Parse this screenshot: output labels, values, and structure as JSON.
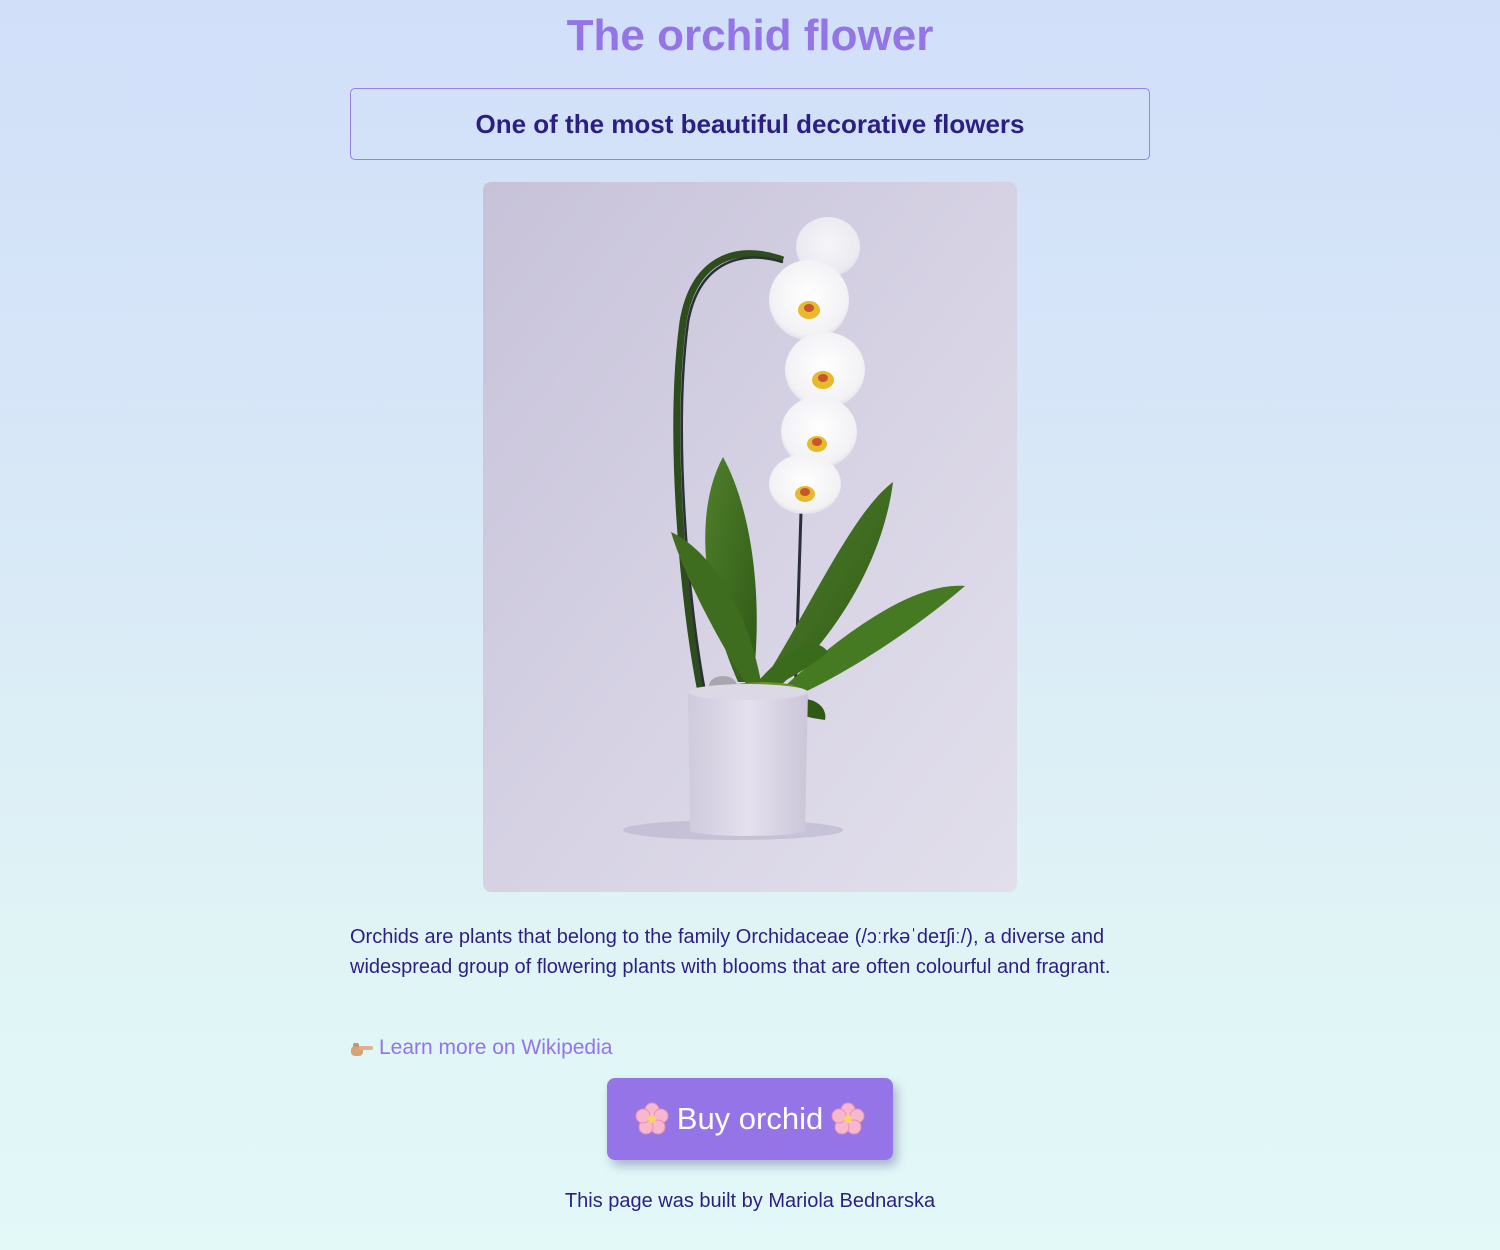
{
  "page": {
    "title": "The orchid flower",
    "subtitle": "One of the most beautiful decorative flowers"
  },
  "image": {
    "alt": "White orchid in a pot"
  },
  "content": {
    "description": "Orchids are plants that belong to the family Orchidaceae (/ɔːrkəˈdeɪʃiː/), a diverse and widespread group of flowering plants with blooms that are often colourful and fragrant."
  },
  "link": {
    "icon": "pointing-hand-icon",
    "label": "Learn more on Wikipedia"
  },
  "button": {
    "label": "Buy orchid",
    "icon": "cherry-blossom-icon"
  },
  "footer": {
    "text": "This page was built by Mariola Bednarska"
  },
  "colors": {
    "accent": "#9474e6",
    "text": "#2c1f82",
    "button_text": "#ffffff"
  }
}
